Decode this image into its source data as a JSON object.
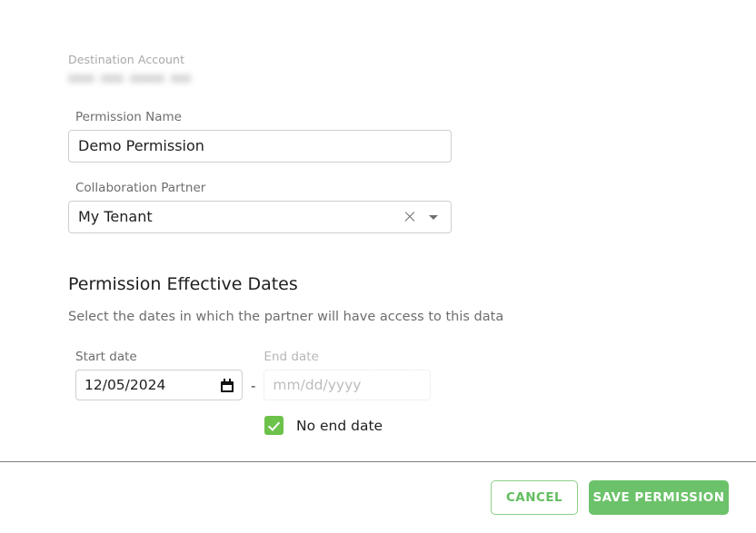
{
  "form": {
    "destination_account": {
      "label": "Destination Account",
      "value_redacted": true
    },
    "permission_name": {
      "label": "Permission Name",
      "value": "Demo Permission"
    },
    "collaboration_partner": {
      "label": "Collaboration Partner",
      "value": "My Tenant",
      "clear_icon": "close-icon",
      "dropdown_icon": "chevron-down-icon"
    }
  },
  "effective_dates": {
    "title": "Permission Effective Dates",
    "subtitle": "Select the dates in which the partner will have access to this data",
    "start": {
      "label": "Start date",
      "value": "12/05/2024",
      "icon": "calendar-icon"
    },
    "separator": "-",
    "end": {
      "label": "End date",
      "value": "",
      "placeholder": "mm/dd/yyyy",
      "disabled": true
    },
    "no_end_date": {
      "label": "No end date",
      "checked": true
    }
  },
  "footer": {
    "cancel_label": "CANCEL",
    "save_label": "SAVE PERMISSION"
  },
  "colors": {
    "accent_green": "#6cc26a",
    "checkbox_green": "#6cc24a",
    "cancel_border": "#8ed08a",
    "label_gray": "#6d6d6d",
    "muted_gray": "#a8a8a8",
    "input_border": "#cfcfcf"
  }
}
